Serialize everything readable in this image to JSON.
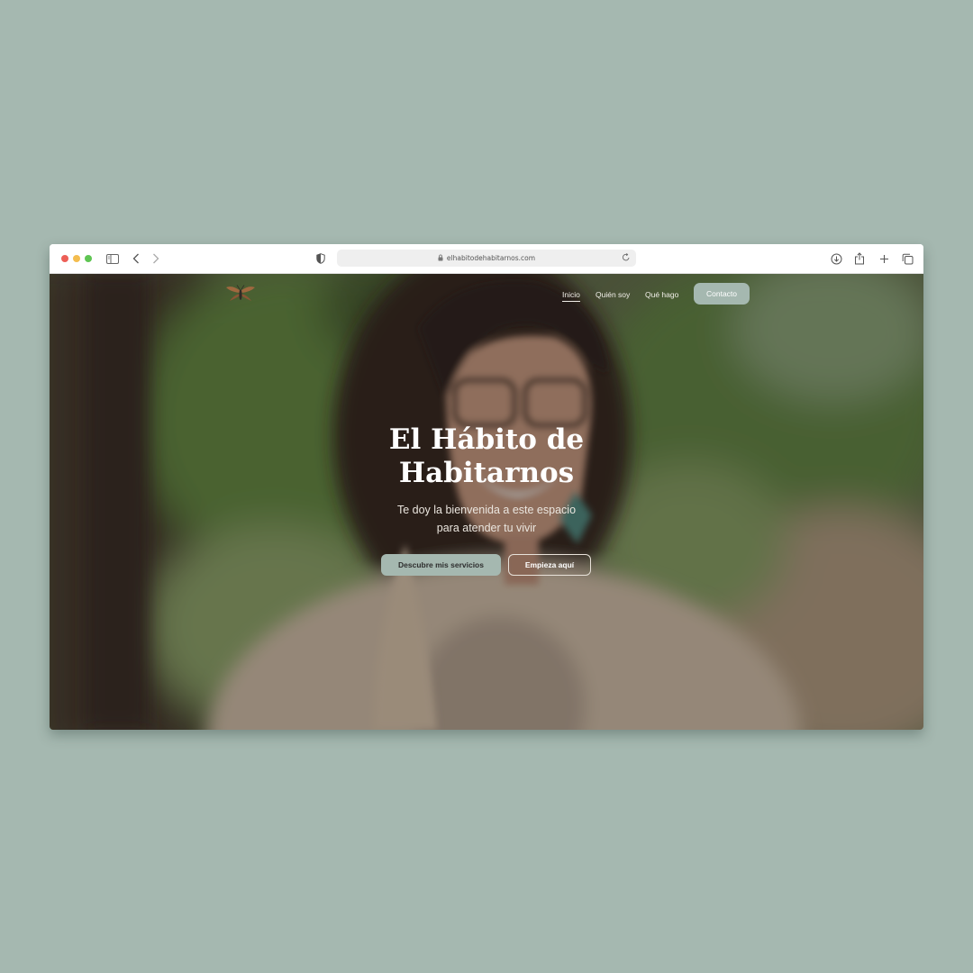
{
  "browser": {
    "url": "elhabitodehabitarnos.com"
  },
  "nav": {
    "items": [
      {
        "label": "Inicio",
        "active": true
      },
      {
        "label": "Quién soy",
        "active": false
      },
      {
        "label": "Qué hago",
        "active": false
      }
    ],
    "contact_label": "Contacto"
  },
  "hero": {
    "title_line1": "El Hábito de",
    "title_line2": "Habitarnos",
    "subtitle_line1": "Te doy la bienvenida a este espacio",
    "subtitle_line2": "para atender tu vivir",
    "primary_button": "Descubre mis servicios",
    "secondary_button": "Empieza aquí"
  },
  "icons": {
    "logo": "insect-logo-icon",
    "sidebar": "sidebar-icon",
    "back": "chevron-left-icon",
    "forward": "chevron-right-icon",
    "privacy": "shield-icon",
    "lock": "lock-icon",
    "reload": "reload-icon",
    "download": "download-icon",
    "share": "share-icon",
    "new_tab": "plus-icon",
    "tabs": "tabs-overview-icon"
  },
  "colors": {
    "page_background": "#a5b8b0",
    "accent": "#a5b8b0"
  }
}
